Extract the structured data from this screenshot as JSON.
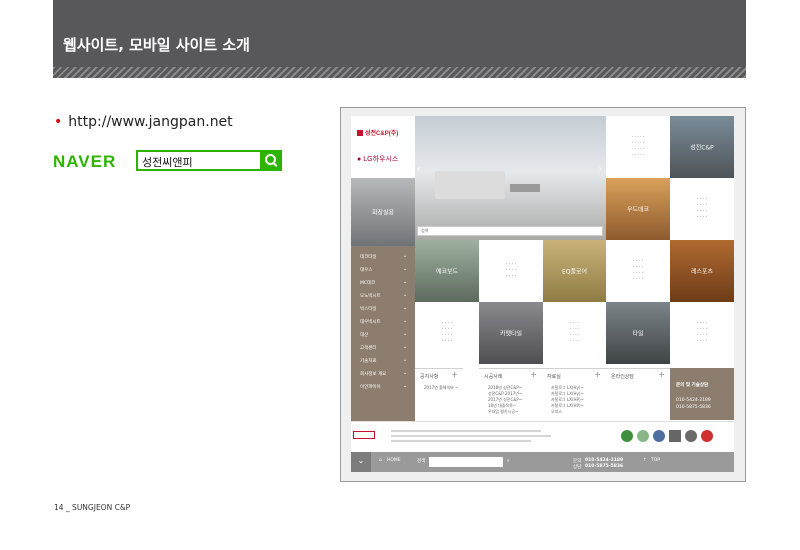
{
  "header": {
    "title": "웹사이트, 모바일 사이트 소개"
  },
  "intro": {
    "bullet": "•",
    "url": "http://www.jangpan.net"
  },
  "naver": {
    "logo": "NAVER",
    "search_value": "성전씨앤피"
  },
  "site": {
    "logo_text": "성전C&P(주)",
    "lg_text": "LG하우시스",
    "tiles": {
      "sungjeon": "성전C&P",
      "hwajang": "화장실용",
      "wood": "우드데코",
      "eco": "에코보드",
      "eq": "EQ플로어",
      "sports": "레스포츠",
      "carpet": "카펫타일",
      "tile2": "타일"
    },
    "sidebar_items": [
      "데코타일",
      "대우스",
      "MC데코",
      "모노빅시트",
      "빅스타일",
      "대우빅시트",
      "대산",
      "고객센터",
      "기술자료",
      "회사정보 개요",
      "이인파이어"
    ],
    "hero_search": "검색",
    "news": [
      {
        "h": "공지사항",
        "lines": [
          "2017년 올해의바 ~"
        ]
      },
      {
        "h": "시공사례",
        "lines": [
          "2018년 성전C&P~",
          "성전C&P 2017년~",
          "2017년 성전C&P~",
          "18년 대중목욕~",
          "우대입 평가시공~"
        ]
      },
      {
        "h": "자료실",
        "lines": [
          "카탈로그 LX(Hy)~",
          "카탈로그 LX(Hy)~",
          "카탈로그 LX(HP)~",
          "카탈로그 LX(HP)~",
          "오피스"
        ]
      },
      {
        "h": "온라인상담",
        "lines": []
      }
    ],
    "contact": {
      "title": "문의 및 기술상담",
      "phone1": "010-5424-2189",
      "phone2": "010-5875-5836"
    },
    "bottom": {
      "home": "HOME",
      "search": "검색",
      "phone_label1": "문의",
      "phone1": "010-5424-2189",
      "phone_label2": "상담",
      "phone2": "010-5875-5836",
      "top": "TOP"
    }
  },
  "footer": {
    "page": "14 _ SUNGJEON C&P"
  },
  "colors": {
    "header": "#58585a",
    "naver": "#2db400",
    "accent": "#8c7d6e"
  }
}
